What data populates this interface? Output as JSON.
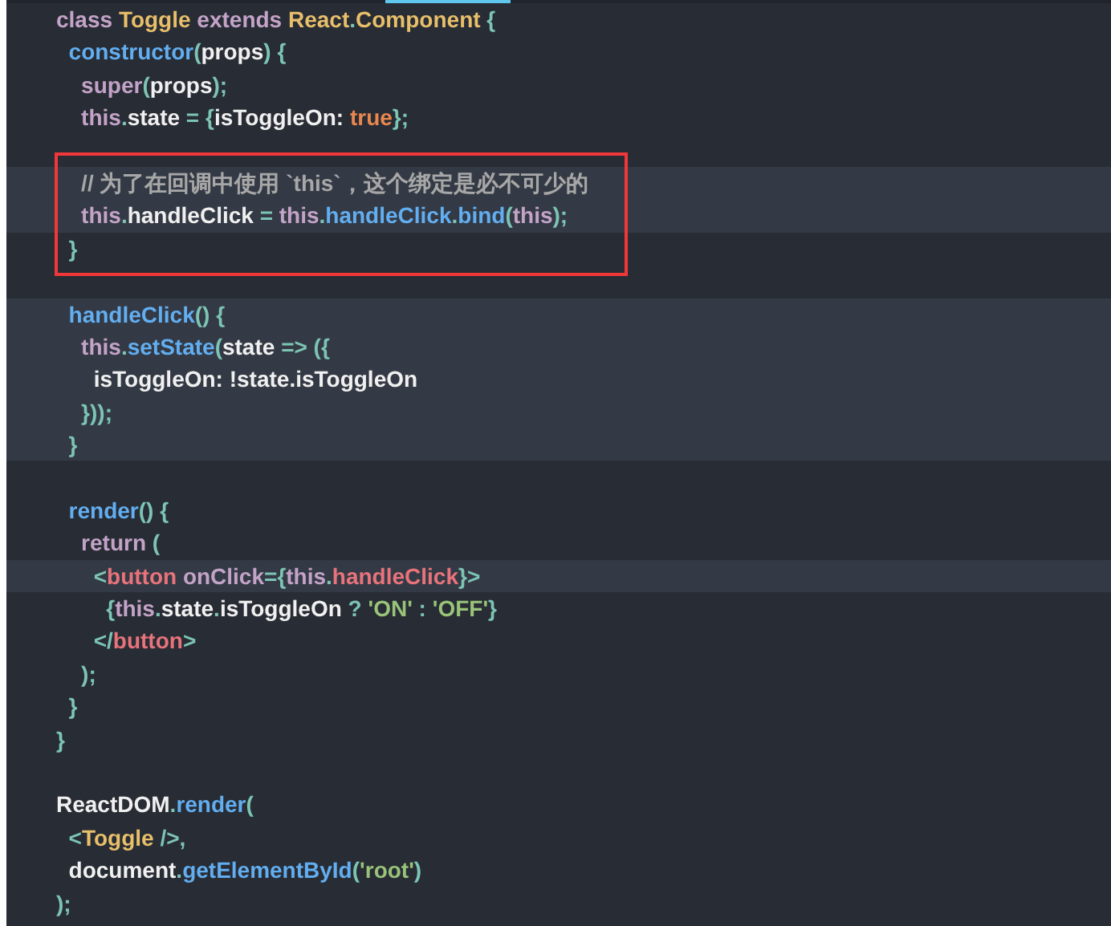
{
  "editor": {
    "lines": [
      {
        "highlighted": false,
        "boxed": false,
        "tokens": [
          {
            "text": "class ",
            "kind": "keyword"
          },
          {
            "text": "Toggle ",
            "kind": "class"
          },
          {
            "text": "extends ",
            "kind": "keyword"
          },
          {
            "text": "React",
            "kind": "class"
          },
          {
            "text": ".",
            "kind": "punct"
          },
          {
            "text": "Component ",
            "kind": "class"
          },
          {
            "text": "{",
            "kind": "punct"
          }
        ]
      },
      {
        "highlighted": false,
        "boxed": false,
        "tokens": [
          {
            "text": "  constructor",
            "kind": "func"
          },
          {
            "text": "(",
            "kind": "punct"
          },
          {
            "text": "props",
            "kind": "plain"
          },
          {
            "text": ") {",
            "kind": "punct"
          }
        ]
      },
      {
        "highlighted": false,
        "boxed": false,
        "tokens": [
          {
            "text": "    super",
            "kind": "keyword"
          },
          {
            "text": "(",
            "kind": "punct"
          },
          {
            "text": "props",
            "kind": "plain"
          },
          {
            "text": ");",
            "kind": "punct"
          }
        ]
      },
      {
        "highlighted": false,
        "boxed": false,
        "tokens": [
          {
            "text": "    this",
            "kind": "keyword"
          },
          {
            "text": ".",
            "kind": "punct"
          },
          {
            "text": "state ",
            "kind": "plain"
          },
          {
            "text": "= {",
            "kind": "punct"
          },
          {
            "text": "isToggleOn: ",
            "kind": "plain"
          },
          {
            "text": "true",
            "kind": "bool"
          },
          {
            "text": "};",
            "kind": "punct"
          }
        ]
      },
      {
        "highlighted": false,
        "boxed": false
      },
      {
        "highlighted": true,
        "boxed": true,
        "tokens": [
          {
            "text": "    // 为了在回调中使用 `this`，这个绑定是必不可少的",
            "kind": "comment"
          }
        ]
      },
      {
        "highlighted": true,
        "boxed": true,
        "tokens": [
          {
            "text": "    this",
            "kind": "keyword"
          },
          {
            "text": ".",
            "kind": "punct"
          },
          {
            "text": "handleClick ",
            "kind": "plain"
          },
          {
            "text": "= ",
            "kind": "punct"
          },
          {
            "text": "this",
            "kind": "keyword"
          },
          {
            "text": ".",
            "kind": "punct"
          },
          {
            "text": "handleClick",
            "kind": "func"
          },
          {
            "text": ".",
            "kind": "punct"
          },
          {
            "text": "bind",
            "kind": "func"
          },
          {
            "text": "(",
            "kind": "punct"
          },
          {
            "text": "this",
            "kind": "keyword"
          },
          {
            "text": ");",
            "kind": "punct"
          }
        ]
      },
      {
        "highlighted": false,
        "boxed": true,
        "tokens": [
          {
            "text": "  }",
            "kind": "punct"
          }
        ]
      },
      {
        "highlighted": false,
        "boxed": false
      },
      {
        "highlighted": true,
        "boxed": false,
        "tokens": [
          {
            "text": "  handleClick",
            "kind": "func"
          },
          {
            "text": "() {",
            "kind": "punct"
          }
        ]
      },
      {
        "highlighted": true,
        "boxed": false,
        "tokens": [
          {
            "text": "    this",
            "kind": "keyword"
          },
          {
            "text": ".",
            "kind": "punct"
          },
          {
            "text": "setState",
            "kind": "func"
          },
          {
            "text": "(",
            "kind": "punct"
          },
          {
            "text": "state ",
            "kind": "plain"
          },
          {
            "text": "=> ({",
            "kind": "punct"
          }
        ]
      },
      {
        "highlighted": true,
        "boxed": false,
        "tokens": [
          {
            "text": "      isToggleOn: !state.isToggleOn",
            "kind": "plain"
          }
        ]
      },
      {
        "highlighted": true,
        "boxed": false,
        "tokens": [
          {
            "text": "    }));",
            "kind": "punct"
          }
        ]
      },
      {
        "highlighted": true,
        "boxed": false,
        "tokens": [
          {
            "text": "  }",
            "kind": "punct"
          }
        ]
      },
      {
        "highlighted": false,
        "boxed": false
      },
      {
        "highlighted": false,
        "boxed": false,
        "tokens": [
          {
            "text": "  render",
            "kind": "func"
          },
          {
            "text": "() {",
            "kind": "punct"
          }
        ]
      },
      {
        "highlighted": false,
        "boxed": false,
        "tokens": [
          {
            "text": "    return ",
            "kind": "keyword"
          },
          {
            "text": "(",
            "kind": "punct"
          }
        ]
      },
      {
        "highlighted": true,
        "boxed": false,
        "tokens": [
          {
            "text": "      <",
            "kind": "punct"
          },
          {
            "text": "button ",
            "kind": "tag"
          },
          {
            "text": "onClick",
            "kind": "attr"
          },
          {
            "text": "={",
            "kind": "punct"
          },
          {
            "text": "this",
            "kind": "keyword"
          },
          {
            "text": ".",
            "kind": "punct"
          },
          {
            "text": "handleClick",
            "kind": "tag"
          },
          {
            "text": "}>",
            "kind": "punct"
          }
        ]
      },
      {
        "highlighted": false,
        "boxed": false,
        "tokens": [
          {
            "text": "        {",
            "kind": "punct"
          },
          {
            "text": "this",
            "kind": "keyword"
          },
          {
            "text": ".",
            "kind": "punct"
          },
          {
            "text": "state",
            "kind": "plain"
          },
          {
            "text": ".",
            "kind": "punct"
          },
          {
            "text": "isToggleOn ",
            "kind": "plain"
          },
          {
            "text": "? ",
            "kind": "punct"
          },
          {
            "text": "'ON'",
            "kind": "string"
          },
          {
            "text": " : ",
            "kind": "punct"
          },
          {
            "text": "'OFF'",
            "kind": "string"
          },
          {
            "text": "}",
            "kind": "punct"
          }
        ]
      },
      {
        "highlighted": false,
        "boxed": false,
        "tokens": [
          {
            "text": "      </",
            "kind": "punct"
          },
          {
            "text": "button",
            "kind": "tag"
          },
          {
            "text": ">",
            "kind": "punct"
          }
        ]
      },
      {
        "highlighted": false,
        "boxed": false,
        "tokens": [
          {
            "text": "    );",
            "kind": "punct"
          }
        ]
      },
      {
        "highlighted": false,
        "boxed": false,
        "tokens": [
          {
            "text": "  }",
            "kind": "punct"
          }
        ]
      },
      {
        "highlighted": false,
        "boxed": false,
        "tokens": [
          {
            "text": "}",
            "kind": "punct"
          }
        ]
      },
      {
        "highlighted": false,
        "boxed": false
      },
      {
        "highlighted": false,
        "boxed": false,
        "tokens": [
          {
            "text": "ReactDOM",
            "kind": "plain"
          },
          {
            "text": ".",
            "kind": "punct"
          },
          {
            "text": "render",
            "kind": "func"
          },
          {
            "text": "(",
            "kind": "punct"
          }
        ]
      },
      {
        "highlighted": false,
        "boxed": false,
        "tokens": [
          {
            "text": "  <",
            "kind": "punct"
          },
          {
            "text": "Toggle ",
            "kind": "class"
          },
          {
            "text": "/>,",
            "kind": "punct"
          }
        ]
      },
      {
        "highlighted": false,
        "boxed": false,
        "tokens": [
          {
            "text": "  document",
            "kind": "plain"
          },
          {
            "text": ".",
            "kind": "punct"
          },
          {
            "text": "getElementById",
            "kind": "func"
          },
          {
            "text": "(",
            "kind": "punct"
          },
          {
            "text": "'root'",
            "kind": "string"
          },
          {
            "text": ")",
            "kind": "punct"
          }
        ]
      },
      {
        "highlighted": false,
        "boxed": false,
        "tokens": [
          {
            "text": ");",
            "kind": "punct"
          }
        ]
      }
    ]
  }
}
